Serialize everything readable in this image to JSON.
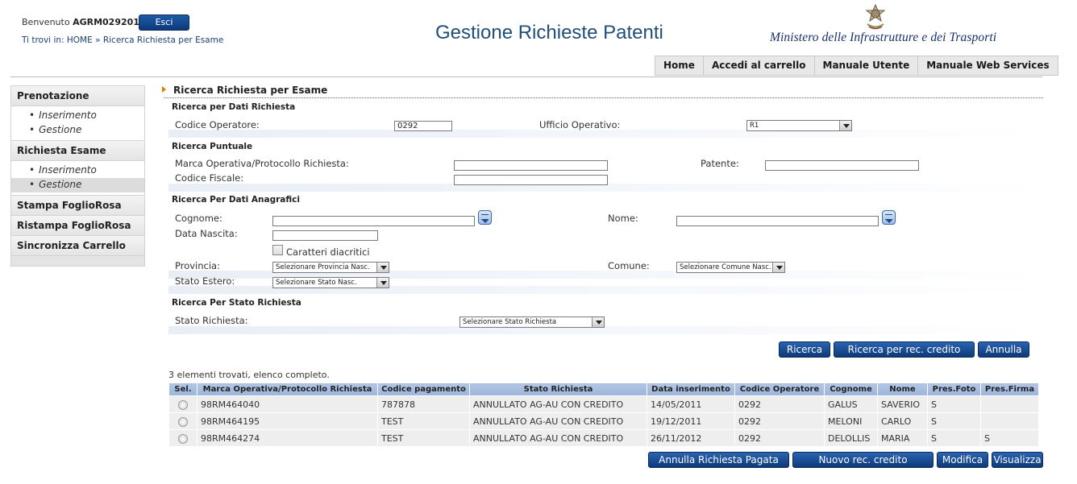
{
  "header": {
    "welcome_prefix": "Benvenuto",
    "username": "AGRM029201",
    "logout_label": "Esci",
    "breadcrumb": "Ti trovi in: HOME » Ricerca Richiesta per Esame",
    "app_title": "Gestione Richieste Patenti",
    "ministry": "Ministero delle Infrastrutture e dei Trasporti"
  },
  "topnav": [
    "Home",
    "Accedi al carrello",
    "Manuale Utente",
    "Manuale Web Services"
  ],
  "sidebar": {
    "prenotazione": "Prenotazione",
    "prenotazione_items": [
      "Inserimento",
      "Gestione"
    ],
    "richiesta_esame": "Richiesta Esame",
    "richiesta_items": [
      "Inserimento",
      "Gestione"
    ],
    "stampa": "Stampa FoglioRosa",
    "ristampa": "Ristampa FoglioRosa",
    "sincronizza": "Sincronizza Carrello"
  },
  "form": {
    "title": "Ricerca Richiesta per Esame",
    "dati_richiesta": {
      "heading": "Ricerca per Dati Richiesta",
      "codice_operatore_label": "Codice Operatore:",
      "codice_operatore_value": "0292",
      "ufficio_label": "Ufficio Operativo:",
      "ufficio_value": "R1"
    },
    "puntuale": {
      "heading": "Ricerca Puntuale",
      "marca_label": "Marca Operativa/Protocollo Richiesta:",
      "patente_label": "Patente:",
      "cf_label": "Codice Fiscale:"
    },
    "anagrafici": {
      "heading": "Ricerca Per Dati Anagrafici",
      "cognome_label": "Cognome:",
      "nome_label": "Nome:",
      "data_nascita_label": "Data Nascita:",
      "diacritici_label": "Caratteri diacritici",
      "provincia_label": "Provincia:",
      "provincia_value": "Selezionare Provincia Nasc.",
      "comune_label": "Comune:",
      "comune_value": "Selezionare Comune Nasc.",
      "stato_estero_label": "Stato Estero:",
      "stato_estero_value": "Selezionare Stato Nasc."
    },
    "stato": {
      "heading": "Ricerca Per Stato Richiesta",
      "label": "Stato Richiesta:",
      "value": "Selezionare Stato Richiesta"
    },
    "buttons": {
      "ricerca": "Ricerca",
      "ricerca_credito": "Ricerca per rec. credito",
      "annulla": "Annulla"
    }
  },
  "results": {
    "count_text": "3 elementi trovati, elenco completo.",
    "columns": [
      "Sel.",
      "Marca Operativa/Protocollo Richiesta",
      "Codice pagamento",
      "Stato Richiesta",
      "Data inserimento",
      "Codice Operatore",
      "Cognome",
      "Nome",
      "Pres.Foto",
      "Pres.Firma"
    ],
    "rows": [
      [
        "98RM464040",
        "787878",
        "ANNULLATO AG-AU CON CREDITO",
        "14/05/2011",
        "0292",
        "GALUS",
        "SAVERIO",
        "S",
        ""
      ],
      [
        "98RM464195",
        "TEST",
        "ANNULLATO AG-AU CON CREDITO",
        "19/12/2011",
        "0292",
        "MELONI",
        "CARLO",
        "S",
        ""
      ],
      [
        "98RM464274",
        "TEST",
        "ANNULLATO AG-AU CON CREDITO",
        "26/11/2012",
        "0292",
        "DELOLLIS",
        "MARIA",
        "S",
        "S"
      ]
    ]
  },
  "actions": {
    "annulla_pagata": "Annulla Richiesta Pagata",
    "nuovo_credito": "Nuovo rec. credito",
    "modifica": "Modifica",
    "visualizza": "Visualizza"
  },
  "colors": {
    "accent": "#0d3a7a",
    "table_header": "#9bb4da",
    "title": "#1f4e79"
  }
}
